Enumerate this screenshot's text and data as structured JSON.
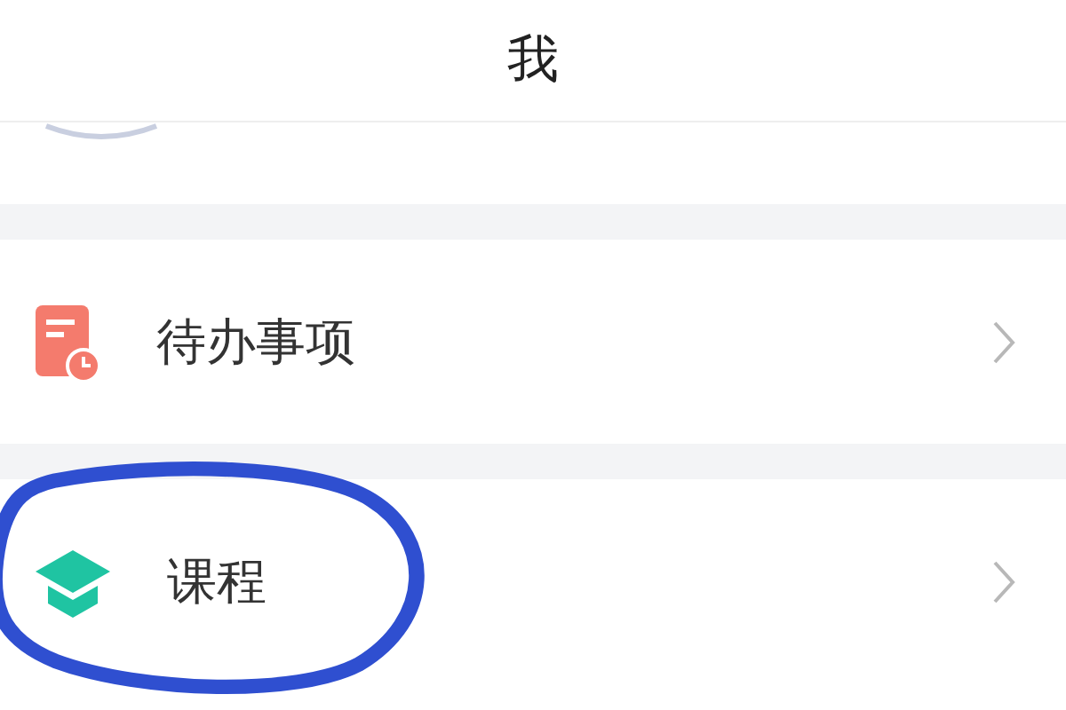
{
  "header": {
    "title": "我"
  },
  "items": [
    {
      "label": "待办事项",
      "circled": false
    },
    {
      "label": "课程",
      "circled": true
    }
  ]
}
